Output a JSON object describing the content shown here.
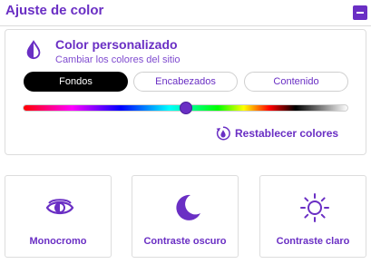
{
  "header": {
    "title": "Ajuste de color",
    "minimize_icon": "minus-square-icon"
  },
  "color_panel": {
    "icon": "half-drop-icon",
    "title": "Color personalizado",
    "subtitle": "Cambiar los colores del sitio",
    "tabs": [
      {
        "label": "Fondos",
        "active": true
      },
      {
        "label": "Encabezados",
        "active": false
      },
      {
        "label": "Contenido",
        "active": false
      }
    ],
    "slider_value": 0.5,
    "reset_label": "Restablecer colores",
    "reset_icon": "reset-drop-icon"
  },
  "options": [
    {
      "label": "Monocromo",
      "icon": "eye-icon"
    },
    {
      "label": "Contraste oscuro",
      "icon": "moon-icon"
    },
    {
      "label": "Contraste claro",
      "icon": "sun-icon"
    }
  ],
  "colors": {
    "accent": "#6a2fc4",
    "active_tab": "#000000",
    "border": "#dddddd"
  }
}
